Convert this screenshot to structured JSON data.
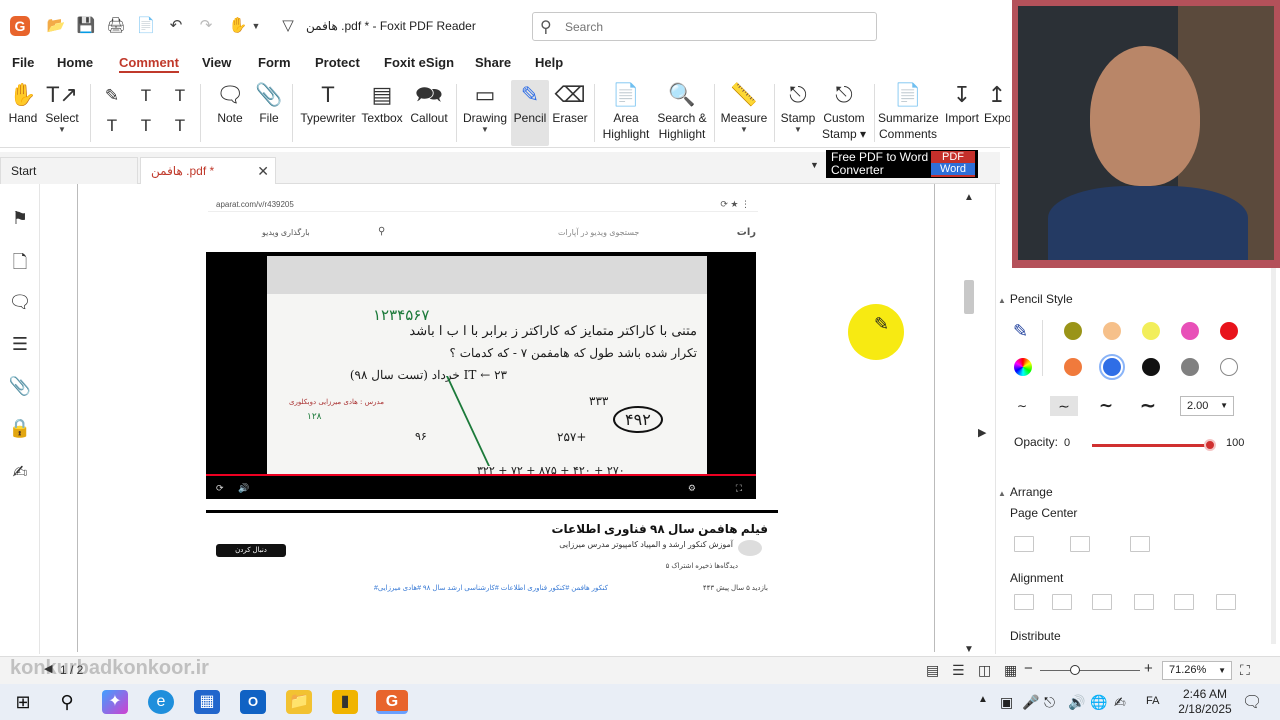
{
  "window": {
    "title": "هافمن .pdf * - Foxit PDF Reader",
    "search_placeholder": "Search",
    "logo_letter": "G"
  },
  "menu": [
    "File",
    "Home",
    "Comment",
    "View",
    "Form",
    "Protect",
    "Foxit eSign",
    "Share",
    "Help"
  ],
  "menu_active": "Comment",
  "ribbon": {
    "hand": "Hand",
    "select": "Select",
    "note": "Note",
    "file": "File",
    "typewriter": "Typewriter",
    "textbox": "Textbox",
    "callout": "Callout",
    "drawing": "Drawing",
    "pencil": "Pencil",
    "eraser": "Eraser",
    "area_highlight_1": "Area",
    "area_highlight_2": "Highlight",
    "search_highlight_1": "Search &",
    "search_highlight_2": "Highlight",
    "measure": "Measure",
    "stamp": "Stamp",
    "custom_stamp_1": "Custom",
    "custom_stamp_2": "Stamp",
    "summarize_1": "Summarize",
    "summarize_2": "Comments",
    "import": "Import",
    "export": "Expo"
  },
  "tabs": {
    "start": "Start",
    "doc": "هافمن .pdf *"
  },
  "ad": {
    "line1": "Free PDF to Word",
    "line2": "Converter",
    "badge_top": "PDF",
    "badge_bottom": "Word"
  },
  "document": {
    "url": "aparat.com/v/r439205",
    "site_label": "رات",
    "upload_label": "بارگذاری ویدیو",
    "search_text": "جستجوی ویدیو در آپارات",
    "board_line1": "۱۲۳۴۵۶۷",
    "board_line2": "متنی با کاراکتر متمایز که کاراکتر ز برابر با ا ب ا باشد",
    "board_line3": "تکرار شده باشد طول که هامفمن ۷ - که کدمات ؟",
    "board_line4": "IT ← ۲۳ خرداد (تست سال ۹۸)",
    "board_teacher": "مدرس : هادی میرزایی دوبکلوری",
    "board_num1": "۳۳۳",
    "board_num2": "۴۹۲",
    "board_num3": "۲۵۷+",
    "board_num4": "۹۶",
    "board_num5": "۱۲۸",
    "board_bottom": "۲۷۰ + ۴۲۰ + ۸۷۵ + ۷۲ + ۳۲۲",
    "video_title": "فیلم هافمن سال ۹۸ فناوری اطلاعات",
    "video_sub": "آموزش کنکور ارشد و المپیاد کامپیوتر مدرس میرزایی",
    "subscribe": "دنبال کردن",
    "actions": "۵    دیدگاه‌ها    ذخیره    اشتراک",
    "views": "۴۴۳ بازدید   ۵ سال پیش",
    "tags": "#کنکور هافمن  #کنکور فناوری اطلاعات  #کارشناسی ارشد سال ۹۸  #هادی میرزایی"
  },
  "right_panel": {
    "pencil_style": "Pencil Style",
    "width_value": "2.00",
    "opacity_label": "Opacity:",
    "opacity_min": "0",
    "opacity_max": "100",
    "arrange": "Arrange",
    "page_center": "Page Center",
    "alignment": "Alignment",
    "distribute": "Distribute",
    "colors": [
      "#9a9418",
      "#f6c08a",
      "#f2ee5a",
      "#e850b8",
      "#e8131b",
      "#f07a3c",
      "#2f6ee6",
      "#111111",
      "#808080",
      "#ffffff"
    ],
    "selected_color": "#2f6ee6"
  },
  "status": {
    "page": "1 / 2",
    "watermark": "konkurbadkonkoor.ir",
    "zoom": "71.26%"
  },
  "clock": {
    "time": "2:46 AM",
    "date": "2/18/2025",
    "lang": "FA"
  }
}
